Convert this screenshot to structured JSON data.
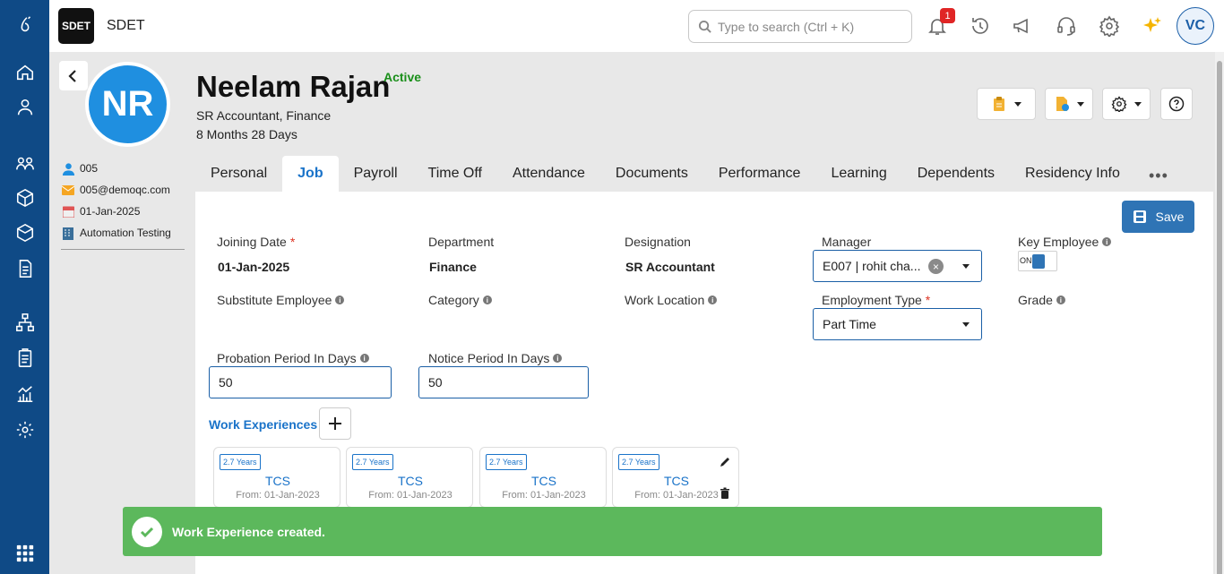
{
  "app": {
    "logo_text": "SDET",
    "name": "SDET"
  },
  "topbar": {
    "search_placeholder": "Type to search (Ctrl + K)",
    "notification_count": "1",
    "user_initials": "VC"
  },
  "employee": {
    "initials": "NR",
    "name": "Neelam Rajan",
    "status": "Active",
    "subtitle": "SR Accountant, Finance",
    "tenure": "8 Months 28 Days",
    "details": {
      "employee_id": "005",
      "email": "005@demoqc.com",
      "joining": "01-Jan-2025",
      "company": "Automation Testing"
    }
  },
  "tabs": [
    "Personal",
    "Job",
    "Payroll",
    "Time Off",
    "Attendance",
    "Documents",
    "Performance",
    "Learning",
    "Dependents",
    "Residency Info"
  ],
  "active_tab": "Job",
  "more_label": "•••",
  "save_label": "Save",
  "fields": {
    "joining_date": {
      "label": "Joining Date",
      "required": "*",
      "value": "01-Jan-2025"
    },
    "department": {
      "label": "Department",
      "value": "Finance"
    },
    "designation": {
      "label": "Designation",
      "value": "SR Accountant"
    },
    "manager": {
      "label": "Manager",
      "value": "E007 | rohit cha..."
    },
    "key_employee": {
      "label": "Key Employee",
      "toggle_text": "ON"
    },
    "substitute_employee": {
      "label": "Substitute Employee"
    },
    "category": {
      "label": "Category"
    },
    "work_location": {
      "label": "Work Location"
    },
    "employment_type": {
      "label": "Employment Type",
      "required": "*",
      "value": "Part Time"
    },
    "grade": {
      "label": "Grade"
    },
    "probation": {
      "label": "Probation Period In Days",
      "value": "50"
    },
    "notice": {
      "label": "Notice Period In Days",
      "value": "50"
    }
  },
  "work_experiences": {
    "title": "Work Experiences",
    "cards": [
      {
        "years": "2.7 Years",
        "company": "TCS",
        "from": "From: 01-Jan-2023"
      },
      {
        "years": "2.7 Years",
        "company": "TCS",
        "from": "From: 01-Jan-2023"
      },
      {
        "years": "2.7 Years",
        "company": "TCS",
        "from": "From: 01-Jan-2023"
      },
      {
        "years": "2.7 Years",
        "company": "TCS",
        "from": "From: 01-Jan-2023"
      }
    ]
  },
  "toast": {
    "message": "Work Experience created."
  },
  "colors": {
    "primary": "#0f4a86",
    "accent": "#1a73c9",
    "success": "#5cb85c",
    "status_active": "#1a8f1a"
  }
}
